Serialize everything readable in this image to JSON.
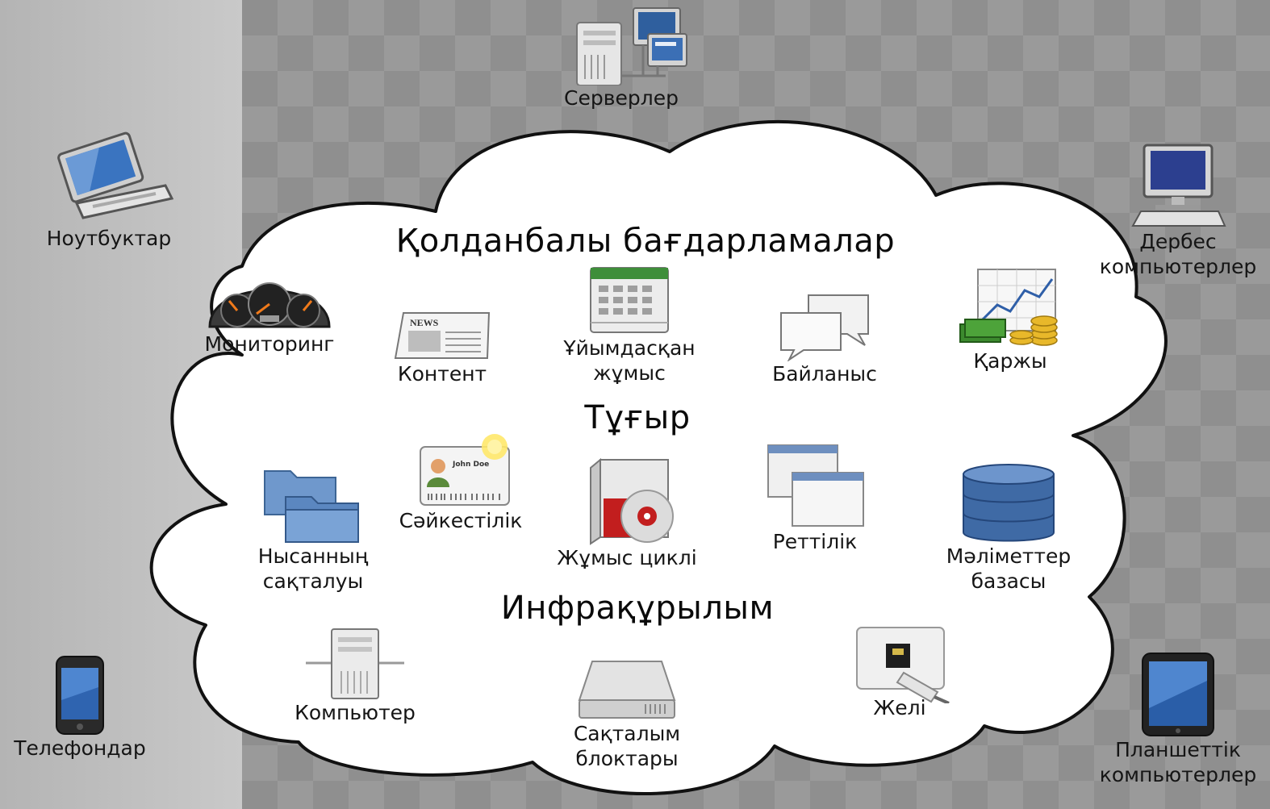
{
  "headings": {
    "applications": "Қолданбалы бағдарламалар",
    "platform": "Тұғыр",
    "infrastructure": "Инфрақұрылым"
  },
  "devices": {
    "servers": "Серверлер",
    "laptops": "Ноутбуктар",
    "desktops": "Дербес\nкомпьютерлер",
    "phones": "Телефондар",
    "tablets": "Планшеттік\nкомпьютерлер"
  },
  "applications": {
    "monitoring": "Мониторинг",
    "content": "Контент",
    "collaboration": "Ұйымдасқан\nжұмыс",
    "communication": "Байланыс",
    "finance": "Қаржы"
  },
  "platform": {
    "object_storage": "Нысанның\nсақталуы",
    "identity": "Сәйкестілік",
    "runtime": "Жұмыс циклі",
    "queue": "Реттілік",
    "database": "Мәліметтер\nбазасы"
  },
  "infrastructure": {
    "compute": "Компьютер",
    "block_storage": "Сақталым\nблоктары",
    "network": "Желі"
  },
  "icon_text": {
    "news": "NEWS",
    "id_name": "John Doe"
  },
  "colors": {
    "cloud_fill": "#ffffff",
    "cloud_stroke": "#111111",
    "left_band": "#c4c4c4",
    "pattern_bg": "#8f8f8f"
  }
}
